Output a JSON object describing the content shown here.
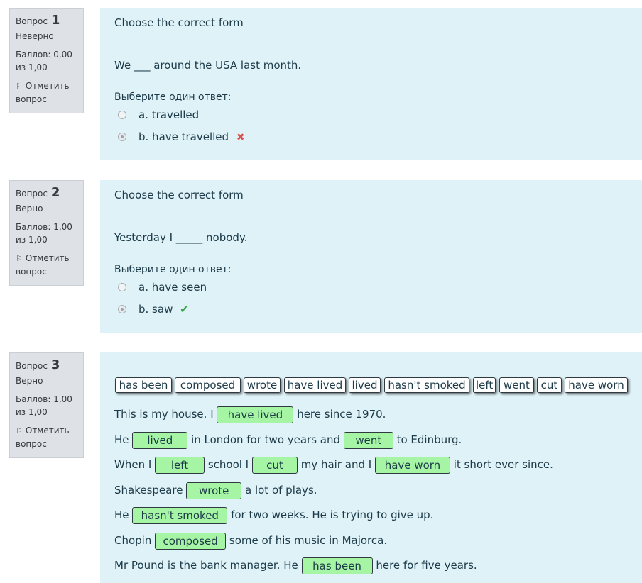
{
  "questions": [
    {
      "label": "Вопрос",
      "number": "1",
      "state": "Неверно",
      "grade": "Баллов: 0,00 из 1,00",
      "flag": "Отметить вопрос",
      "text": "Choose the correct form",
      "sentence": "We ___ around the USA last month.",
      "prompt": "Выберите один ответ:",
      "answers": [
        "a. travelled",
        "b. have travelled"
      ],
      "selected": "b"
    },
    {
      "label": "Вопрос",
      "number": "2",
      "state": "Верно",
      "grade": "Баллов: 1,00 из 1,00",
      "flag": "Отметить вопрос",
      "text": "Choose the correct form",
      "sentence": "Yesterday I _____ nobody.",
      "prompt": "Выберите один ответ:",
      "answers": [
        "a. have seen",
        "b. saw"
      ],
      "selected": "b"
    },
    {
      "label": "Вопрос",
      "number": "3",
      "state": "Верно",
      "grade": "Баллов: 1,00 из 1,00",
      "flag": "Отметить вопрос",
      "choices": [
        "has been",
        "composed",
        "wrote",
        "have lived",
        "lived",
        "hasn't smoked",
        "left",
        "went",
        "cut",
        "have worn"
      ],
      "lines": [
        [
          "This is my house. I",
          "have lived",
          "here since 1970."
        ],
        [
          "He",
          "lived",
          "in London for two years and",
          "went",
          "to Edinburg."
        ],
        [
          "When I",
          "left",
          "school I",
          "cut",
          "my hair and I",
          "have worn",
          "it short ever since."
        ],
        [
          "Shakespeare",
          "wrote",
          "a lot of plays."
        ],
        [
          "He",
          "hasn't smoked",
          "for two weeks. He is trying to give up."
        ],
        [
          "Chopin",
          "composed",
          "some of his music in Majorca."
        ],
        [
          "Mr Pound is the bank manager. He",
          "has been",
          "here for five years."
        ]
      ]
    }
  ],
  "colors": {
    "info_bg": "#dee2e6",
    "content_bg": "#def2f8",
    "drop_bg": "#a5f5a5",
    "incorrect": "#d9534f",
    "correct": "#3fa34d"
  },
  "icons": [
    "flag-icon",
    "incorrect-icon",
    "correct-icon"
  ]
}
